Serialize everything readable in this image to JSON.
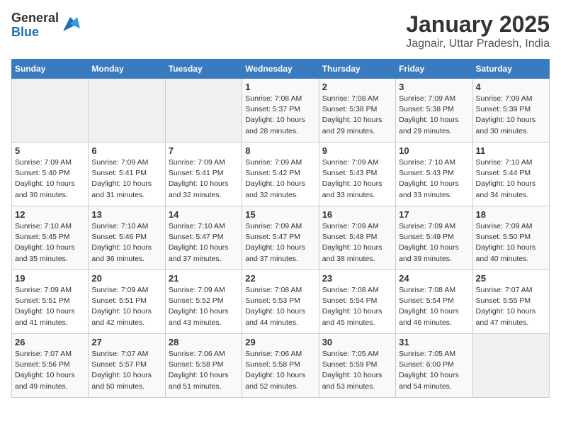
{
  "header": {
    "logo_general": "General",
    "logo_blue": "Blue",
    "title": "January 2025",
    "subtitle": "Jagnair, Uttar Pradesh, India"
  },
  "weekdays": [
    "Sunday",
    "Monday",
    "Tuesday",
    "Wednesday",
    "Thursday",
    "Friday",
    "Saturday"
  ],
  "weeks": [
    [
      {
        "day": "",
        "empty": true
      },
      {
        "day": "",
        "empty": true
      },
      {
        "day": "",
        "empty": true
      },
      {
        "day": "1",
        "sunrise": "7:08 AM",
        "sunset": "5:37 PM",
        "daylight": "10 hours and 28 minutes."
      },
      {
        "day": "2",
        "sunrise": "7:08 AM",
        "sunset": "5:38 PM",
        "daylight": "10 hours and 29 minutes."
      },
      {
        "day": "3",
        "sunrise": "7:09 AM",
        "sunset": "5:38 PM",
        "daylight": "10 hours and 29 minutes."
      },
      {
        "day": "4",
        "sunrise": "7:09 AM",
        "sunset": "5:39 PM",
        "daylight": "10 hours and 30 minutes."
      }
    ],
    [
      {
        "day": "5",
        "sunrise": "7:09 AM",
        "sunset": "5:40 PM",
        "daylight": "10 hours and 30 minutes."
      },
      {
        "day": "6",
        "sunrise": "7:09 AM",
        "sunset": "5:41 PM",
        "daylight": "10 hours and 31 minutes."
      },
      {
        "day": "7",
        "sunrise": "7:09 AM",
        "sunset": "5:41 PM",
        "daylight": "10 hours and 32 minutes."
      },
      {
        "day": "8",
        "sunrise": "7:09 AM",
        "sunset": "5:42 PM",
        "daylight": "10 hours and 32 minutes."
      },
      {
        "day": "9",
        "sunrise": "7:09 AM",
        "sunset": "5:43 PM",
        "daylight": "10 hours and 33 minutes."
      },
      {
        "day": "10",
        "sunrise": "7:10 AM",
        "sunset": "5:43 PM",
        "daylight": "10 hours and 33 minutes."
      },
      {
        "day": "11",
        "sunrise": "7:10 AM",
        "sunset": "5:44 PM",
        "daylight": "10 hours and 34 minutes."
      }
    ],
    [
      {
        "day": "12",
        "sunrise": "7:10 AM",
        "sunset": "5:45 PM",
        "daylight": "10 hours and 35 minutes."
      },
      {
        "day": "13",
        "sunrise": "7:10 AM",
        "sunset": "5:46 PM",
        "daylight": "10 hours and 36 minutes."
      },
      {
        "day": "14",
        "sunrise": "7:10 AM",
        "sunset": "5:47 PM",
        "daylight": "10 hours and 37 minutes."
      },
      {
        "day": "15",
        "sunrise": "7:09 AM",
        "sunset": "5:47 PM",
        "daylight": "10 hours and 37 minutes."
      },
      {
        "day": "16",
        "sunrise": "7:09 AM",
        "sunset": "5:48 PM",
        "daylight": "10 hours and 38 minutes."
      },
      {
        "day": "17",
        "sunrise": "7:09 AM",
        "sunset": "5:49 PM",
        "daylight": "10 hours and 39 minutes."
      },
      {
        "day": "18",
        "sunrise": "7:09 AM",
        "sunset": "5:50 PM",
        "daylight": "10 hours and 40 minutes."
      }
    ],
    [
      {
        "day": "19",
        "sunrise": "7:09 AM",
        "sunset": "5:51 PM",
        "daylight": "10 hours and 41 minutes."
      },
      {
        "day": "20",
        "sunrise": "7:09 AM",
        "sunset": "5:51 PM",
        "daylight": "10 hours and 42 minutes."
      },
      {
        "day": "21",
        "sunrise": "7:09 AM",
        "sunset": "5:52 PM",
        "daylight": "10 hours and 43 minutes."
      },
      {
        "day": "22",
        "sunrise": "7:08 AM",
        "sunset": "5:53 PM",
        "daylight": "10 hours and 44 minutes."
      },
      {
        "day": "23",
        "sunrise": "7:08 AM",
        "sunset": "5:54 PM",
        "daylight": "10 hours and 45 minutes."
      },
      {
        "day": "24",
        "sunrise": "7:08 AM",
        "sunset": "5:54 PM",
        "daylight": "10 hours and 46 minutes."
      },
      {
        "day": "25",
        "sunrise": "7:07 AM",
        "sunset": "5:55 PM",
        "daylight": "10 hours and 47 minutes."
      }
    ],
    [
      {
        "day": "26",
        "sunrise": "7:07 AM",
        "sunset": "5:56 PM",
        "daylight": "10 hours and 49 minutes."
      },
      {
        "day": "27",
        "sunrise": "7:07 AM",
        "sunset": "5:57 PM",
        "daylight": "10 hours and 50 minutes."
      },
      {
        "day": "28",
        "sunrise": "7:06 AM",
        "sunset": "5:58 PM",
        "daylight": "10 hours and 51 minutes."
      },
      {
        "day": "29",
        "sunrise": "7:06 AM",
        "sunset": "5:58 PM",
        "daylight": "10 hours and 52 minutes."
      },
      {
        "day": "30",
        "sunrise": "7:05 AM",
        "sunset": "5:59 PM",
        "daylight": "10 hours and 53 minutes."
      },
      {
        "day": "31",
        "sunrise": "7:05 AM",
        "sunset": "6:00 PM",
        "daylight": "10 hours and 54 minutes."
      },
      {
        "day": "",
        "empty": true
      }
    ]
  ],
  "labels": {
    "sunrise": "Sunrise:",
    "sunset": "Sunset:",
    "daylight": "Daylight:"
  }
}
